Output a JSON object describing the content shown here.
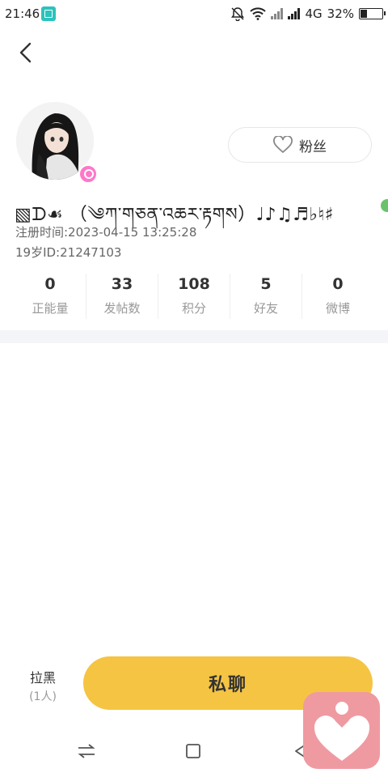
{
  "status_bar": {
    "time": "21:46",
    "network": "4G",
    "battery_percent": "32%",
    "battery_level": 0.32
  },
  "profile": {
    "name": "▧ᗪ☙ （༄ཀ་གཅན་འཆར་རྟགས）♩♪♫♬♭♮♯",
    "registered": "注册时间:2023-04-15 13:25:28",
    "age_id": "19岁ID:21247103",
    "fans_label": "粉丝"
  },
  "stats": [
    {
      "value": "0",
      "label": "正能量"
    },
    {
      "value": "33",
      "label": "发帖数"
    },
    {
      "value": "108",
      "label": "积分"
    },
    {
      "value": "5",
      "label": "好友"
    },
    {
      "value": "0",
      "label": "微博"
    }
  ],
  "actions": {
    "block_label": "拉黑",
    "block_count": "(1人)",
    "private_message_label": "私聊"
  },
  "colors": {
    "accent": "#f6c443",
    "badge": "#ff77c8",
    "online": "#6ac36a",
    "float_app": "#ef9aa1"
  },
  "icons": [
    "back-icon",
    "heart-outline-icon",
    "female-icon",
    "swap-icon",
    "home-square-icon",
    "back-triangle-icon",
    "heart-app-icon"
  ]
}
